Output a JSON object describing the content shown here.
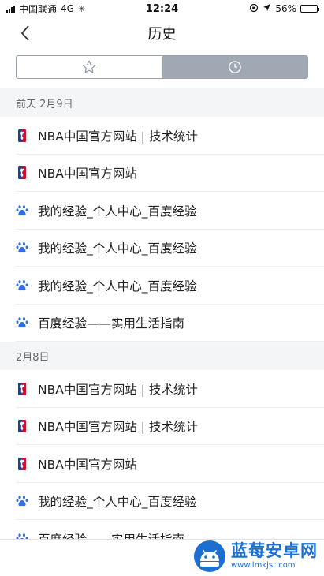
{
  "status_bar": {
    "carrier": "中国联通",
    "network": "4G",
    "time": "12:24",
    "battery": "56%",
    "battery_level": 0.56
  },
  "nav": {
    "title": "历史",
    "back_icon": "chevron-left-icon"
  },
  "segments": [
    {
      "icon": "star-icon",
      "active": false
    },
    {
      "icon": "clock-icon",
      "active": true
    }
  ],
  "groups": [
    {
      "date": "前天  2月9日",
      "items": [
        {
          "icon": "nba-icon",
          "title": "NBA中国官方网站 | 技术统计"
        },
        {
          "icon": "nba-icon",
          "title": "NBA中国官方网站"
        },
        {
          "icon": "baidu-paw-icon",
          "title": "我的经验_个人中心_百度经验"
        },
        {
          "icon": "baidu-paw-icon",
          "title": "我的经验_个人中心_百度经验"
        },
        {
          "icon": "baidu-paw-icon",
          "title": "我的经验_个人中心_百度经验"
        },
        {
          "icon": "baidu-paw-icon",
          "title": "百度经验——实用生活指南"
        }
      ]
    },
    {
      "date": "2月8日",
      "items": [
        {
          "icon": "nba-icon",
          "title": "NBA中国官方网站 | 技术统计"
        },
        {
          "icon": "nba-icon",
          "title": "NBA中国官方网站 | 技术统计"
        },
        {
          "icon": "nba-icon",
          "title": "NBA中国官方网站"
        },
        {
          "icon": "baidu-paw-icon",
          "title": "我的经验_个人中心_百度经验"
        },
        {
          "icon": "baidu-paw-icon",
          "title": "百度经验——实用生活指南"
        }
      ]
    }
  ],
  "watermark": {
    "title": "蓝莓安卓网",
    "url": "www.lmkjst.com"
  },
  "colors": {
    "active_segment": "#a0a9b3",
    "header_bg": "#f4f5f7",
    "baidu_blue": "#2f6fe0",
    "nba_red": "#c8102e",
    "nba_blue": "#1d428a",
    "watermark_blue": "#1c6fd1"
  }
}
